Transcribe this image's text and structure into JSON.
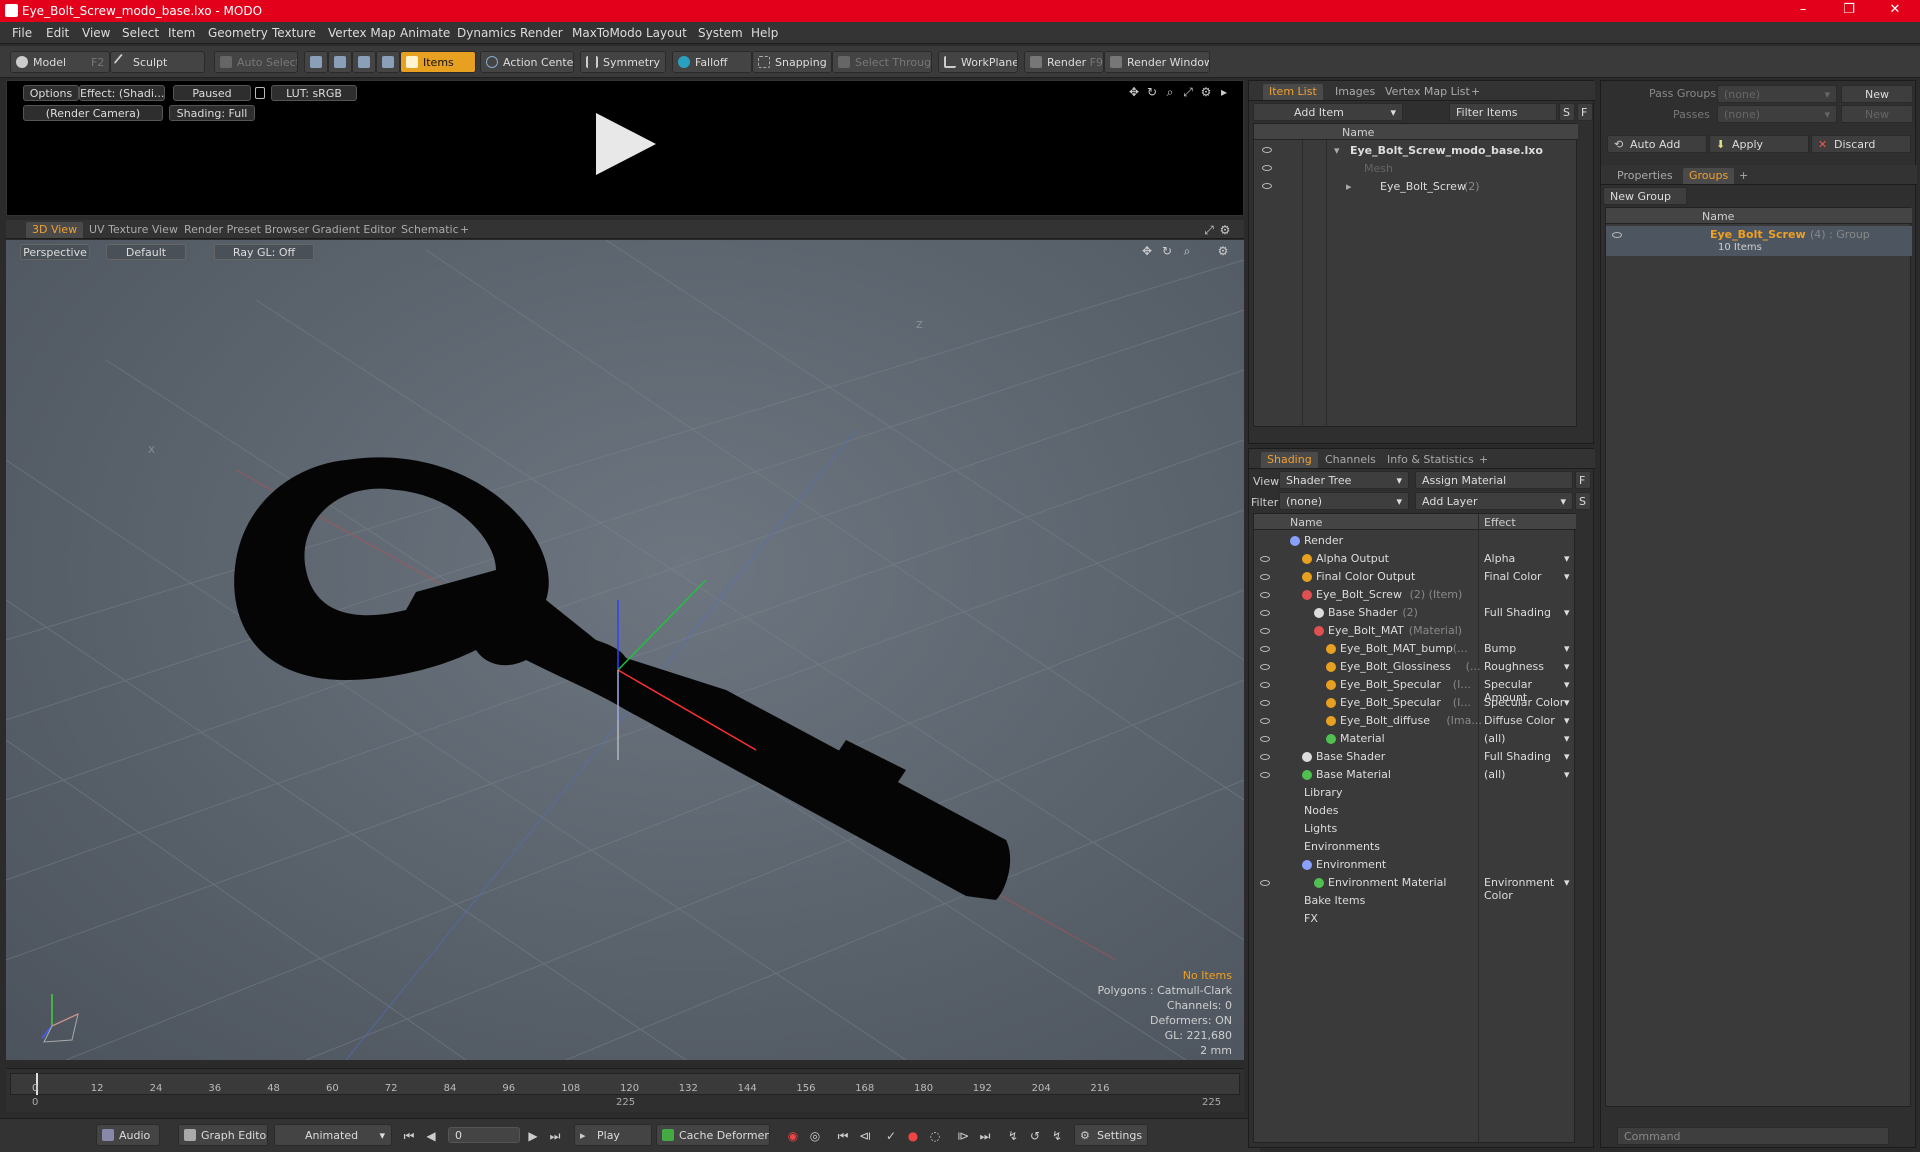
{
  "window": {
    "title": "Eye_Bolt_Screw_modo_base.lxo - MODO",
    "minimize": "–",
    "maximize": "❐",
    "close": "✕"
  },
  "menu": [
    "File",
    "Edit",
    "View",
    "Select",
    "Item",
    "Geometry",
    "Texture",
    "Vertex Map",
    "Animate",
    "Dynamics",
    "Render",
    "MaxToModo",
    "Layout",
    "System",
    "Help"
  ],
  "toolbar": {
    "model": "Model",
    "model_key": "F2",
    "sculpt": "Sculpt",
    "auto_select": "Auto Select",
    "items": "Items",
    "action_center": "Action Center",
    "symmetry": "Symmetry",
    "falloff": "Falloff",
    "snapping": "Snapping",
    "select_through": "Select Through",
    "workplane": "WorkPlane",
    "render": "Render",
    "render_key": "F9",
    "render_window": "Render Window"
  },
  "preview": {
    "options": "Options",
    "effect": "Effect: (Shadi...",
    "paused": "Paused",
    "lut": "LUT: sRGB",
    "camera": "(Render Camera)",
    "shading": "Shading: Full"
  },
  "viewport_tabs": [
    "3D View",
    "UV Texture View",
    "Render Preset Browser",
    "Gradient Editor",
    "Schematic"
  ],
  "viewport": {
    "perspective": "Perspective",
    "default": "Default",
    "raygl": "Ray GL: Off",
    "axis_z": "Z",
    "axis_x": "X",
    "stats": [
      "No Items",
      "Polygons : Catmull-Clark",
      "Channels: 0",
      "Deformers: ON",
      "GL: 221,680",
      "2 mm"
    ]
  },
  "timeline": {
    "ticks": [
      "0",
      "12",
      "24",
      "36",
      "48",
      "60",
      "72",
      "84",
      "96",
      "108",
      "120",
      "132",
      "144",
      "156",
      "168",
      "180",
      "192",
      "204",
      "216"
    ],
    "start": "0",
    "mid": "225",
    "end": "225"
  },
  "bottom": {
    "audio": "Audio",
    "graph_editor": "Graph Editor",
    "animated": "Animated",
    "frame": "0",
    "play": "Play",
    "cache": "Cache Deformers",
    "settings": "Settings"
  },
  "itemlist": {
    "tabs": [
      "Item List",
      "Images",
      "Vertex Map List"
    ],
    "add_item": "Add Item",
    "filter": "Filter Items",
    "s": "S",
    "f": "F",
    "col_name": "Name",
    "rows": [
      {
        "name": "Eye_Bolt_Screw_modo_base.lxo",
        "extra": ""
      },
      {
        "name": "Mesh",
        "extra": ""
      },
      {
        "name": "Eye_Bolt_Screw",
        "extra": "(2)"
      }
    ]
  },
  "shading": {
    "tabs": [
      "Shading",
      "Channels",
      "Info & Statistics"
    ],
    "view_label": "View",
    "view_value": "Shader Tree",
    "assign": "Assign Material",
    "filter_label": "Filter",
    "filter_value": "(none)",
    "add_layer": "Add Layer",
    "col_name": "Name",
    "col_effect": "Effect",
    "rows": [
      {
        "name": "Render",
        "extra": "",
        "effect": ""
      },
      {
        "name": "Alpha Output",
        "extra": "",
        "effect": "Alpha"
      },
      {
        "name": "Final Color Output",
        "extra": "",
        "effect": "Final Color"
      },
      {
        "name": "Eye_Bolt_Screw",
        "extra": "(2) (Item)",
        "effect": ""
      },
      {
        "name": "Base Shader",
        "extra": "(2)",
        "effect": "Full Shading"
      },
      {
        "name": "Eye_Bolt_MAT",
        "extra": "(Material)",
        "effect": ""
      },
      {
        "name": "Eye_Bolt_MAT_bump",
        "extra": "(...",
        "effect": "Bump"
      },
      {
        "name": "Eye_Bolt_Glossiness",
        "extra": "(...",
        "effect": "Roughness"
      },
      {
        "name": "Eye_Bolt_Specular",
        "extra": "(I...",
        "effect": "Specular Amount"
      },
      {
        "name": "Eye_Bolt_Specular",
        "extra": "(I...",
        "effect": "Specular Color"
      },
      {
        "name": "Eye_Bolt_diffuse",
        "extra": "(Ima...",
        "effect": "Diffuse Color"
      },
      {
        "name": "Material",
        "extra": "",
        "effect": "(all)"
      },
      {
        "name": "Base Shader",
        "extra": "",
        "effect": "Full Shading"
      },
      {
        "name": "Base Material",
        "extra": "",
        "effect": "(all)"
      },
      {
        "name": "Library",
        "extra": "",
        "effect": ""
      },
      {
        "name": "Nodes",
        "extra": "",
        "effect": ""
      },
      {
        "name": "Lights",
        "extra": "",
        "effect": ""
      },
      {
        "name": "Environments",
        "extra": "",
        "effect": ""
      },
      {
        "name": "Environment",
        "extra": "",
        "effect": ""
      },
      {
        "name": "Environment Material",
        "extra": "",
        "effect": "Environment Color"
      },
      {
        "name": "Bake Items",
        "extra": "",
        "effect": ""
      },
      {
        "name": "FX",
        "extra": "",
        "effect": ""
      }
    ]
  },
  "right": {
    "pass_groups": "Pass Groups",
    "passes": "Passes",
    "none": "(none)",
    "new": "New",
    "auto_add": "Auto Add",
    "apply": "Apply",
    "discard": "Discard",
    "tabs": [
      "Properties",
      "Groups"
    ],
    "new_group": "New Group",
    "col_name": "Name",
    "group_name": "Eye_Bolt_Screw",
    "group_extra": "(4) : Group",
    "group_items": "10 Items",
    "command": "Command"
  }
}
